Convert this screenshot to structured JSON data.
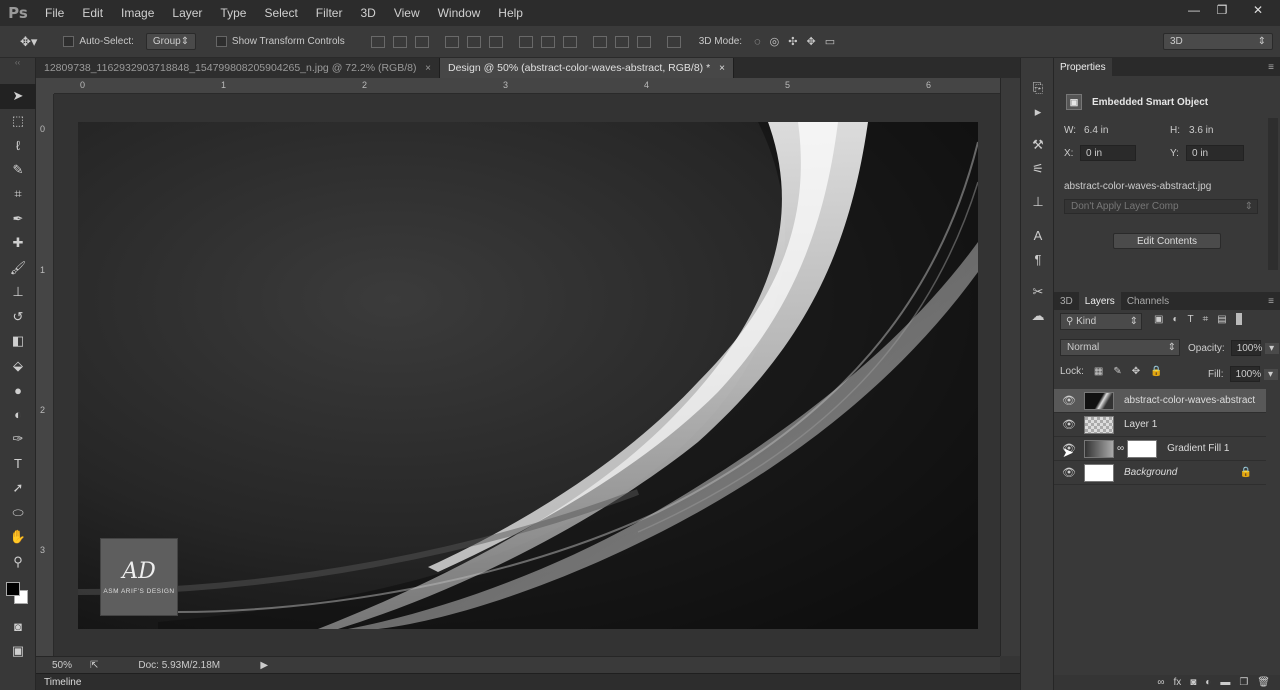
{
  "app": {
    "logo": "Ps"
  },
  "menu": [
    "File",
    "Edit",
    "Image",
    "Layer",
    "Type",
    "Select",
    "Filter",
    "3D",
    "View",
    "Window",
    "Help"
  ],
  "options": {
    "auto_select_label": "Auto-Select:",
    "auto_select_value": "Group",
    "transform_label": "Show Transform Controls",
    "mode_label": "3D Mode:",
    "workspace": "3D"
  },
  "tabs": [
    {
      "label": "12809738_1162932903718848_1547998082059042​65_n.jpg @ 72.2% (RGB/8) *"
    },
    {
      "label": "Design @ 50% (abstract-color-waves-abstract, RGB/8) *"
    }
  ],
  "ruler": {
    "h": [
      "0",
      "1",
      "2",
      "3",
      "4",
      "5",
      "6"
    ],
    "v": [
      "0",
      "1",
      "2",
      "3"
    ]
  },
  "logo_box": {
    "monogram": "AD",
    "caption": "ASM ARIF'S DESIGN"
  },
  "status": {
    "zoom": "50%",
    "doc": "Doc: 5.93M/2.18M"
  },
  "timeline": {
    "label": "Timeline"
  },
  "properties": {
    "tab": "Properties",
    "title": "Embedded Smart Object",
    "w_label": "W:",
    "w_value": "6.4 in",
    "h_label": "H:",
    "h_value": "3.6 in",
    "x_label": "X:",
    "x_value": "0 in",
    "y_label": "Y:",
    "y_value": "0 in",
    "file": "abstract-color-waves-abstract.jpg",
    "layer_comp": "Don't Apply Layer Comp",
    "edit_button": "Edit Contents"
  },
  "layers_panel": {
    "tabs": [
      "3D",
      "Layers",
      "Channels"
    ],
    "kind": "Kind",
    "blend": "Normal",
    "opacity_label": "Opacity:",
    "opacity": "100%",
    "lock_label": "Lock:",
    "fill_label": "Fill:",
    "fill": "100%",
    "layers": [
      {
        "name": "abstract-color-waves-abstract"
      },
      {
        "name": "Layer 1"
      },
      {
        "name": "Gradient Fill 1"
      },
      {
        "name": "Background"
      }
    ]
  }
}
